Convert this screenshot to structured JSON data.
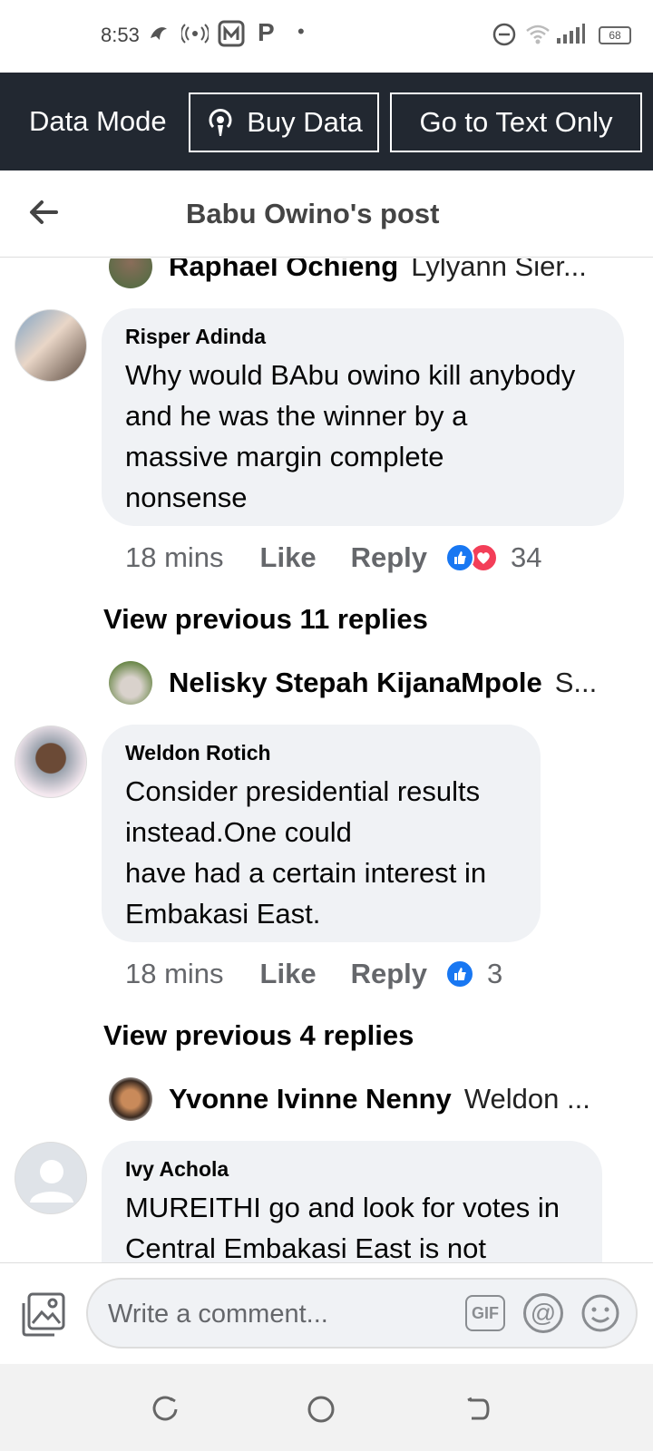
{
  "status_bar": {
    "time": "8:53",
    "battery": "68",
    "p_icon": "P"
  },
  "data_mode": {
    "label": "Data Mode",
    "buy_data": "Buy Data",
    "text_only": "Go to Text Only"
  },
  "header": {
    "title": "Babu Owino's post"
  },
  "comments": [
    {
      "reply_preview": {
        "name": "Raphael Ochieng",
        "text": "Lylyann Sier..."
      },
      "author": "Risper Adinda",
      "body": "Why would BAbu owino kill anybody\nand he was the winner by a\nmassive margin complete\nnonsense",
      "time": "18 mins",
      "like": "Like",
      "reply": "Reply",
      "reactions": [
        "like-icon",
        "love-icon"
      ],
      "reaction_count": "34"
    },
    {
      "view_previous": "View previous 11 replies",
      "reply_preview": {
        "name": "Nelisky Stepah KijanaMpole",
        "text": "S..."
      },
      "author": "Weldon Rotich",
      "body": "Consider presidential results\ninstead.One  could\nhave had a certain interest in\nEmbakasi East.",
      "time": "18 mins",
      "like": "Like",
      "reply": "Reply",
      "reactions": [
        "like-icon"
      ],
      "reaction_count": "3"
    },
    {
      "view_previous": "View previous 4 replies",
      "reply_preview": {
        "name": "Yvonne Ivinne Nenny",
        "text": "Weldon ..."
      },
      "author": "Ivy Achola",
      "body": "MUREITHI go and look for votes in\nCentral Embakasi East is not"
    }
  ],
  "comment_bar": {
    "placeholder": "Write a comment...",
    "gif": "GIF",
    "at": "@"
  },
  "colors": {
    "data_bar_bg": "#222831",
    "bubble_bg": "#f0f2f5",
    "like_blue": "#1877f2",
    "love_red": "#f33e58",
    "meta_gray": "#65676b"
  }
}
